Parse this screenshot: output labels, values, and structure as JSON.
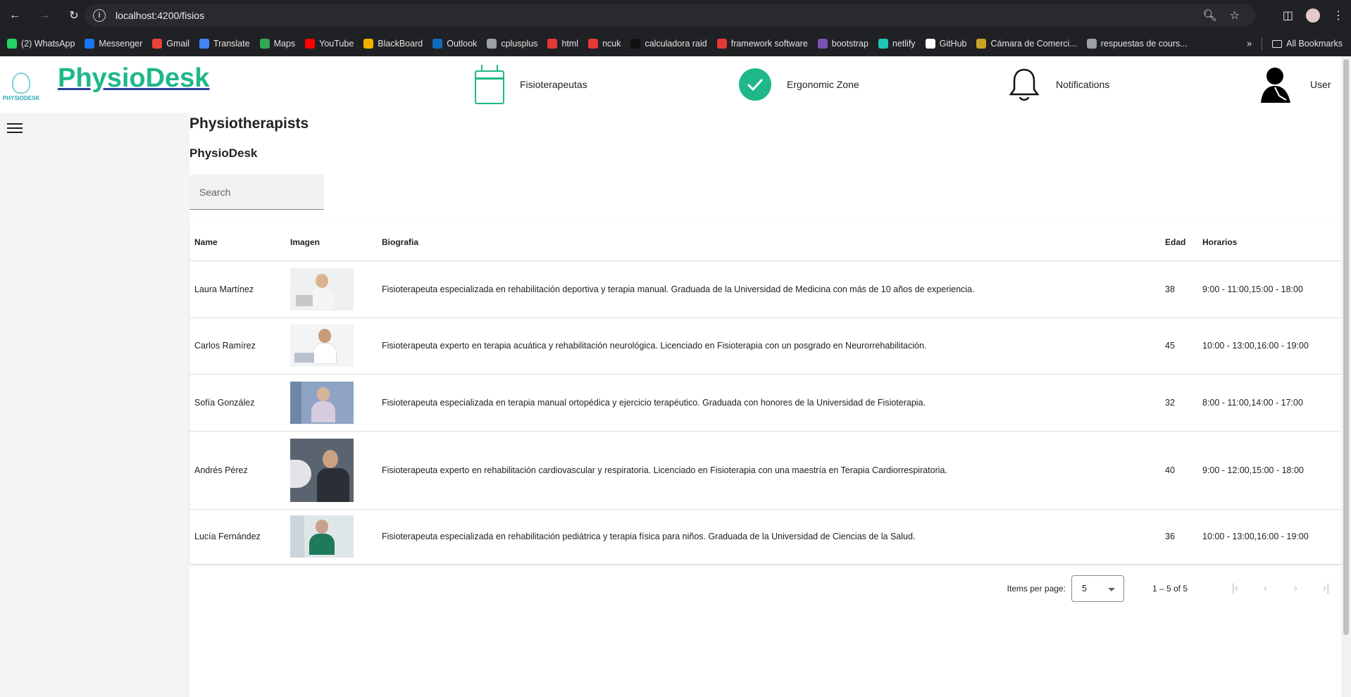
{
  "browser": {
    "url": "localhost:4200/fisios",
    "bookmarks": [
      {
        "label": "(2) WhatsApp",
        "icon": "whatsapp-icon",
        "color": "#25d366"
      },
      {
        "label": "Messenger",
        "icon": "facebook-icon",
        "color": "#1877f2"
      },
      {
        "label": "Gmail",
        "icon": "gmail-icon",
        "color": "#ea4335"
      },
      {
        "label": "Translate",
        "icon": "translate-icon",
        "color": "#4285f4"
      },
      {
        "label": "Maps",
        "icon": "maps-icon",
        "color": "#34a853"
      },
      {
        "label": "YouTube",
        "icon": "youtube-icon",
        "color": "#ff0000"
      },
      {
        "label": "BlackBoard",
        "icon": "blackboard-icon",
        "color": "#f2b300"
      },
      {
        "label": "Outlook",
        "icon": "outlook-icon",
        "color": "#0f6cbd"
      },
      {
        "label": "cplusplus",
        "icon": "cplusplus-icon",
        "color": "#9aa0a6"
      },
      {
        "label": "html",
        "icon": "html-icon",
        "color": "#e53935"
      },
      {
        "label": "ncuk",
        "icon": "ncuk-icon",
        "color": "#e53935"
      },
      {
        "label": "calculadora raid",
        "icon": "raid-icon",
        "color": "#111111"
      },
      {
        "label": "framework software",
        "icon": "framework-icon",
        "color": "#e53935"
      },
      {
        "label": "bootstrap",
        "icon": "bootstrap-icon",
        "color": "#7952b3"
      },
      {
        "label": "netlify",
        "icon": "netlify-icon",
        "color": "#20c6b7"
      },
      {
        "label": "GitHub",
        "icon": "github-icon",
        "color": "#ffffff"
      },
      {
        "label": "Cámara de Comerci...",
        "icon": "camara-icon",
        "color": "#c9a227"
      },
      {
        "label": "respuestas de cours...",
        "icon": "page-icon",
        "color": "#9aa0a6"
      }
    ],
    "all_bookmarks": "All Bookmarks"
  },
  "header": {
    "logo_text": "PHYSIODESK",
    "brand": "PhysioDesk",
    "nav": [
      {
        "label": "Fisioterapeutas",
        "icon": "calendar-icon"
      },
      {
        "label": "Ergonomic Zone",
        "icon": "check-circle-icon"
      },
      {
        "label": "Notifications",
        "icon": "bell-icon"
      },
      {
        "label": "User",
        "icon": "user-icon"
      }
    ],
    "accent_color": "#1eb889"
  },
  "main": {
    "title": "Physiotherapists",
    "subtitle": "PhysioDesk",
    "search_placeholder": "Search",
    "table": {
      "columns": [
        "Name",
        "Imagen",
        "Biografia",
        "Edad",
        "Horarios"
      ],
      "rows": [
        {
          "name": "Laura Martínez",
          "bio": "Fisioterapeuta especializada en rehabilitación deportiva y terapia manual. Graduada de la Universidad de Medicina con más de 10 años de experiencia.",
          "edad": "38",
          "horarios": "9:00 - 11:00,15:00 - 18:00"
        },
        {
          "name": "Carlos Ramírez",
          "bio": "Fisioterapeuta experto en terapia acuática y rehabilitación neurológica. Licenciado en Fisioterapia con un posgrado en Neurorrehabilitación.",
          "edad": "45",
          "horarios": "10:00 - 13:00,16:00 - 19:00"
        },
        {
          "name": "Sofía González",
          "bio": "Fisioterapeuta especializada en terapia manual ortopédica y ejercicio terapéutico. Graduada con honores de la Universidad de Fisioterapia.",
          "edad": "32",
          "horarios": "8:00 - 11:00,14:00 - 17:00"
        },
        {
          "name": "Andrés Pérez",
          "bio": "Fisioterapeuta experto en rehabilitación cardiovascular y respiratoria. Licenciado en Fisioterapia con una maestría en Terapia Cardiorrespiratoria.",
          "edad": "40",
          "horarios": "9:00 - 12:00,15:00 - 18:00"
        },
        {
          "name": "Lucía Fernández",
          "bio": "Fisioterapeuta especializada en rehabilitación pediátrica y terapia física para niños. Graduada de la Universidad de Ciencias de la Salud.",
          "edad": "36",
          "horarios": "10:00 - 13:00,16:00 - 19:00"
        }
      ]
    },
    "paginator": {
      "items_per_page_label": "Items per page:",
      "page_size": "5",
      "range": "1 – 5 of 5"
    }
  }
}
